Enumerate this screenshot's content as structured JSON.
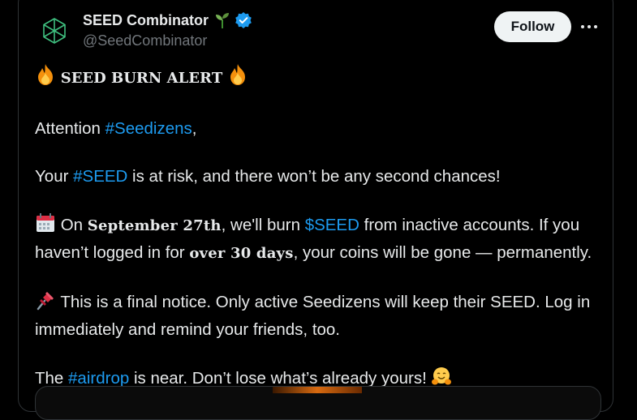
{
  "author": {
    "display_name": "SEED Combinator",
    "handle": "@SeedCombinator",
    "sprout_icon": "seedling-emoji",
    "verified_icon": "verified-badge-icon",
    "verified_color": "#1d9bf0"
  },
  "actions": {
    "follow_label": "Follow",
    "more_icon": "more-dots-icon"
  },
  "tweet": {
    "title": "𝐒𝐄𝐄𝐃 𝐁𝐔𝐑𝐍 𝐀𝐋𝐄𝐑𝐓",
    "attention_prefix": "Attention ",
    "attention_hashtag": "#Seedizens",
    "attention_suffix": ",",
    "line2_prefix": "Your ",
    "line2_hashtag": "#SEED",
    "line2_suffix": " is at risk, and there won’t be any second chances!",
    "line3_prefix": " On ",
    "line3_date": "September 27th",
    "line3_mid": ", we'll burn ",
    "line3_cashtag": "$SEED",
    "line3_after": " from inactive accounts. If you haven’t logged in for ",
    "line3_period": "over 30 days",
    "line3_suffix": ", your coins will be gone — permanently.",
    "line4_text": " This is a final notice. Only active Seedizens will keep their SEED. Log in immediately and remind your friends, too.",
    "line5_prefix": "The ",
    "line5_hashtag": "#airdrop",
    "line5_suffix": " is near. Don’t lose what’s already yours! "
  },
  "colors": {
    "background": "#000000",
    "text": "#e7e9ea",
    "secondary_text": "#71767b",
    "link": "#1d9bf0",
    "border": "#2f3336",
    "follow_bg": "#eff3f4"
  }
}
